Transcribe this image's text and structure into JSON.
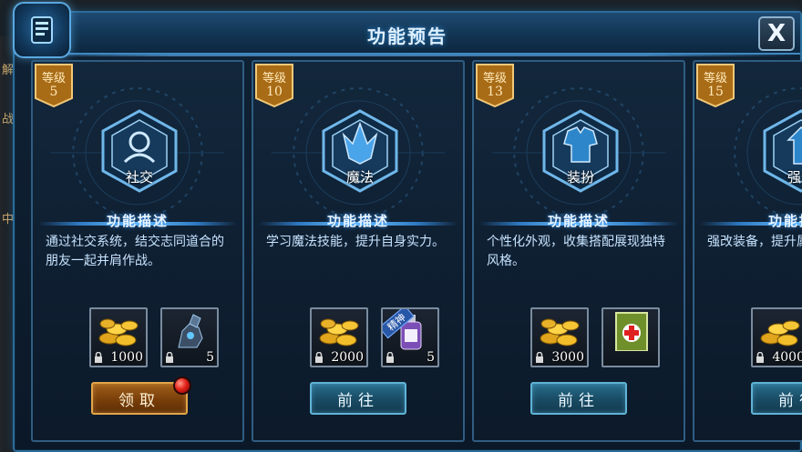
{
  "window": {
    "title": "功能预告",
    "close_label": "X"
  },
  "background": {
    "left_text": [
      "解",
      "战)",
      "中)"
    ]
  },
  "cards": [
    {
      "level_label": "等级",
      "level": "5",
      "feature": "社交",
      "desc_title": "功能描述",
      "desc": "通过社交系统，结交志同道合的朋友一起并肩作战。",
      "rewards": [
        {
          "icon": "gold-coins-icon",
          "count": "1000"
        },
        {
          "icon": "mech-armor-icon",
          "count": "5"
        }
      ],
      "button": "领取",
      "button_type": "claim"
    },
    {
      "level_label": "等级",
      "level": "10",
      "feature": "魔法",
      "desc_title": "功能描述",
      "desc": "学习魔法技能，提升自身实力。",
      "rewards": [
        {
          "icon": "gold-coins-icon",
          "count": "2000"
        },
        {
          "icon": "potion-bottle-icon",
          "count": "5",
          "ribbon": "精神"
        }
      ],
      "button": "前往",
      "button_type": "go"
    },
    {
      "level_label": "等级",
      "level": "13",
      "feature": "装扮",
      "desc_title": "功能描述",
      "desc": "个性化外观，收集搭配展现独特风格。",
      "rewards": [
        {
          "icon": "gold-coins-icon",
          "count": "3000"
        },
        {
          "icon": "medkit-card-icon",
          "count": ""
        }
      ],
      "button": "前往",
      "button_type": "go"
    },
    {
      "level_label": "等级",
      "level": "15",
      "feature": "强化",
      "desc_title": "功能描述",
      "desc": "强改装备，提升属性。",
      "rewards": [
        {
          "icon": "gold-coins-icon",
          "count": "4000"
        }
      ],
      "button": "前往",
      "button_type": "go"
    }
  ],
  "colors": {
    "frame": "#2b6c9a",
    "accent": "#6cc0ff",
    "claim": "#a05f1a",
    "go": "#2a6f8e",
    "level_tag": "#b97820"
  }
}
